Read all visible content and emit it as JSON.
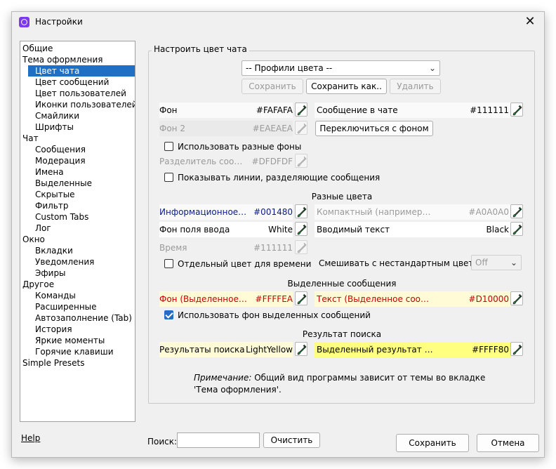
{
  "window": {
    "title": "Настройки",
    "close": "✕"
  },
  "tree": {
    "items": [
      {
        "label": "Общие",
        "level": 0
      },
      {
        "label": "Тема оформления",
        "level": 0
      },
      {
        "label": "Цвет чата",
        "level": 1,
        "selected": true
      },
      {
        "label": "Цвет сообщений",
        "level": 1
      },
      {
        "label": "Цвет пользователей",
        "level": 1
      },
      {
        "label": "Иконки пользователей",
        "level": 1
      },
      {
        "label": "Смайлики",
        "level": 1
      },
      {
        "label": "Шрифты",
        "level": 1
      },
      {
        "label": "Чат",
        "level": 0
      },
      {
        "label": "Сообщения",
        "level": 1
      },
      {
        "label": "Модерация",
        "level": 1
      },
      {
        "label": "Имена",
        "level": 1
      },
      {
        "label": "Выделенные",
        "level": 1
      },
      {
        "label": "Скрытые",
        "level": 1
      },
      {
        "label": "Фильтр",
        "level": 1
      },
      {
        "label": "Custom Tabs",
        "level": 1
      },
      {
        "label": "Лог",
        "level": 1
      },
      {
        "label": "Окно",
        "level": 0
      },
      {
        "label": "Вкладки",
        "level": 1
      },
      {
        "label": "Уведомления",
        "level": 1
      },
      {
        "label": "Эфиры",
        "level": 1
      },
      {
        "label": "Другое",
        "level": 0
      },
      {
        "label": "Команды",
        "level": 1
      },
      {
        "label": "Расширенные",
        "level": 1
      },
      {
        "label": "Автозаполнение (Tab)",
        "level": 1
      },
      {
        "label": "История",
        "level": 1
      },
      {
        "label": "Яркие моменты",
        "level": 1
      },
      {
        "label": "Горячие клавиши",
        "level": 1
      },
      {
        "label": "Simple Presets",
        "level": 0
      }
    ]
  },
  "panel": {
    "group_title": "Настроить цвет чата",
    "profiles_combo": "-- Профили цвета --",
    "save": "Сохранить",
    "save_as": "Сохранить как..",
    "delete": "Удалить",
    "switch_bg": "Переключиться с фоном",
    "background": {
      "label": "Фон",
      "value": "#FAFAFA"
    },
    "background2": {
      "label": "Фон 2",
      "value": "#EAEAEA"
    },
    "chat_message": {
      "label": "Сообщение в чате",
      "value": "#111111"
    },
    "use_different_bg": "Использовать разные фоны",
    "separator": {
      "label": "Разделитель сообщ...",
      "value": "#DFDFDF"
    },
    "show_separator_lines": "Показывать линии, разделяющие сообщения",
    "misc_colors_title": "Разные цвета",
    "info_message": {
      "label": "Информационное с...",
      "value": "#001480",
      "color": "#0a1a8a"
    },
    "compact": {
      "label": "Компактный (например, M...",
      "value": "#A0A0A0"
    },
    "input_bg": {
      "label": "Фон поля ввода",
      "value": "White"
    },
    "input_text": {
      "label": "Вводимый текст",
      "value": "Black"
    },
    "time": {
      "label": "Время",
      "value": "#111111"
    },
    "separate_time_color": "Отдельный цвет для времени",
    "mix_label": "Смешивать с нестандартным цветом:",
    "mix_value": "Off",
    "highlighted_title": "Выделенные сообщения",
    "hl_bg": {
      "label": "Фон (Выделенное с...",
      "value": "#FFFFEA",
      "color": "#c80000"
    },
    "hl_text": {
      "label": "Текст (Выделенное сообще...",
      "value": "#D10000",
      "color": "#c80000"
    },
    "use_hl_bg": "Использовать фон выделенных сообщений",
    "search_title": "Результат поиска",
    "search_results": {
      "label": "Результаты поиска",
      "value": "LightYellow"
    },
    "search_selected": {
      "label": "Выделенный результат пои...",
      "value": "#FFFF80"
    },
    "note_label": "Примечание:",
    "note_text": "Общий вид программы зависит от темы во вкладке 'Тема оформления'."
  },
  "footer": {
    "help": "Help",
    "search_label": "Поиск:",
    "clear": "Очистить",
    "save": "Сохранить",
    "cancel": "Отмена"
  },
  "colors": {
    "selection": "#1f6fc5",
    "light_yellow_bg": "#fffbd6",
    "bright_yellow_bg": "#ffff80",
    "row_bg": "#fafafa",
    "disabled_row_bg": "#eaeaea"
  }
}
